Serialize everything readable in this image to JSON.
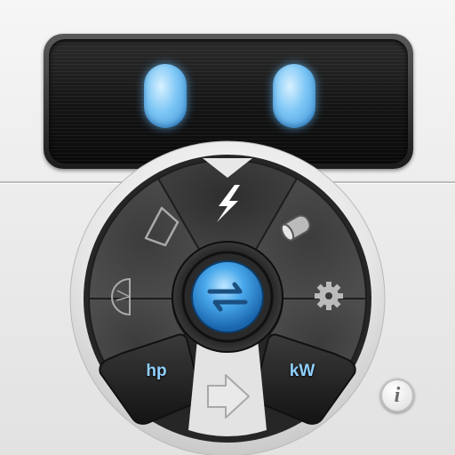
{
  "display": {
    "digit_left": "0",
    "digit_right": "0"
  },
  "categories": [
    {
      "name": "power",
      "icon": "lightning-bolt-icon",
      "selected": true
    },
    {
      "name": "volume",
      "icon": "barrel-icon",
      "selected": false
    },
    {
      "name": "settings",
      "icon": "gear-icon",
      "selected": false
    },
    {
      "name": "angle",
      "icon": "protractor-icon",
      "selected": false
    },
    {
      "name": "area",
      "icon": "quadrilateral-icon",
      "selected": false
    }
  ],
  "swap_icon": "swap-arrows-icon",
  "direction_icon": "right-arrow-icon",
  "units": {
    "from": "hp",
    "to": "kW"
  },
  "info_button_label": "i",
  "colors": {
    "accent_blue": "#4aa9ec",
    "unit_text": "#8fd0ff",
    "dial_dark": "#3a3a3a"
  }
}
